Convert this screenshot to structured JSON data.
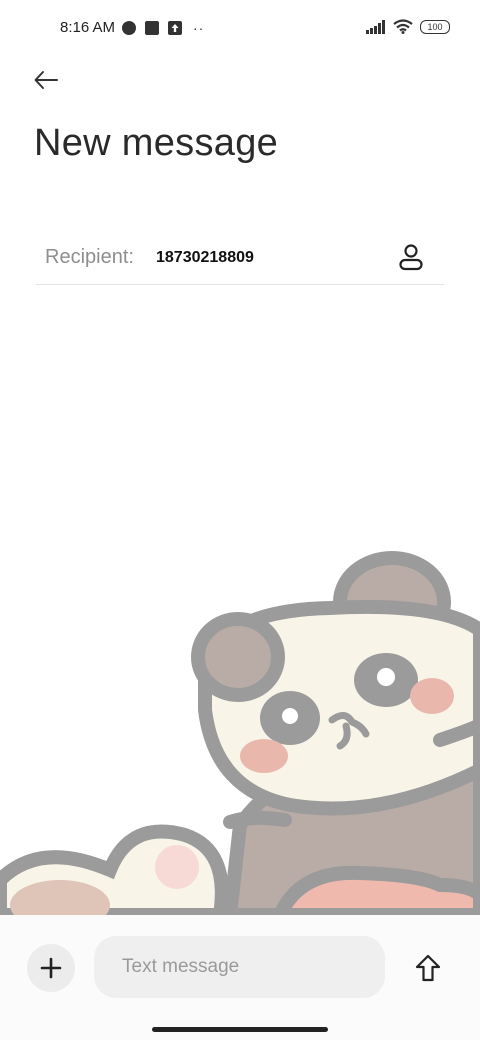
{
  "status_bar": {
    "time": "8:16 AM",
    "battery": "100",
    "left_icons": [
      "vpn-icon",
      "notification-square-icon",
      "upload-icon",
      "more-dots-icon"
    ],
    "right_icons": [
      "signal-icon",
      "wifi-icon",
      "battery-icon"
    ]
  },
  "header": {
    "back_icon": "arrow-left-icon",
    "title": "New message"
  },
  "recipient": {
    "label": "Recipient:",
    "value": "18730218809",
    "contact_icon": "person-icon"
  },
  "background": {
    "art": "panda-illustration"
  },
  "compose": {
    "attach_icon": "plus-icon",
    "placeholder": "Text message",
    "send_icon": "arrow-up-icon"
  },
  "colors": {
    "text_primary": "#2a2a2a",
    "text_muted": "#8e8e8e",
    "input_bg": "#efefef",
    "panda_outline": "#9b9b9b",
    "panda_face": "#f8f5e8",
    "panda_cheek": "#eab7ac",
    "panda_body": "#b9aba5"
  }
}
